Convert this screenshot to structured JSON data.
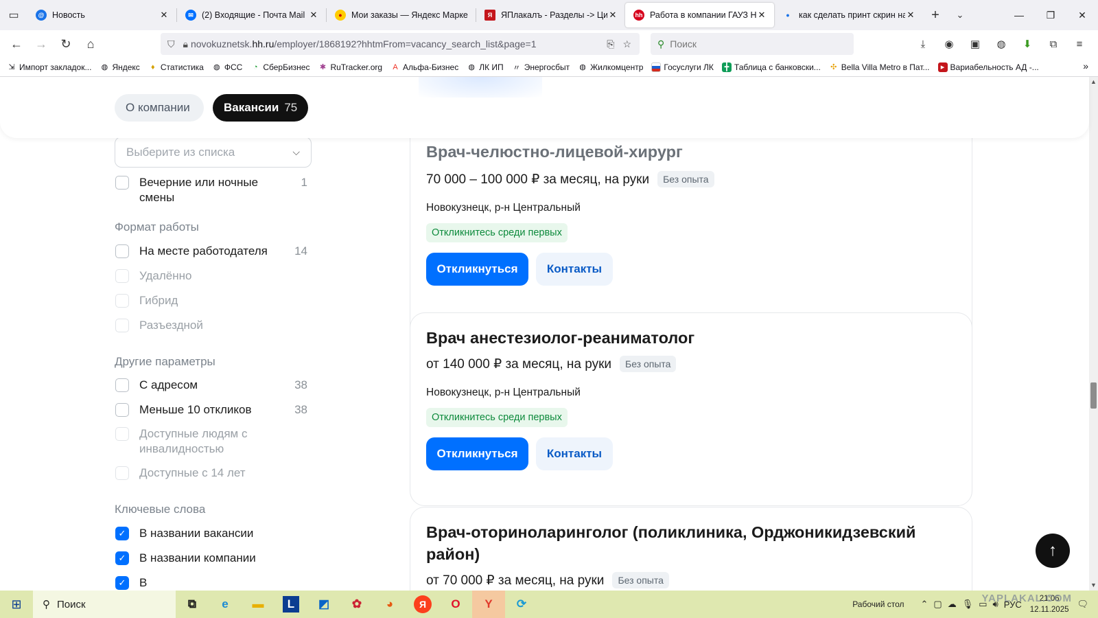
{
  "browser": {
    "tabs": [
      {
        "title": "Новость",
        "icon": "at-icon",
        "color": "#1a73e8",
        "active": false
      },
      {
        "title": "(2) Входящие - Почта Mail",
        "icon": "mail-icon",
        "color": "#0070ff",
        "active": false
      },
      {
        "title": "Мои заказы — Яндекс Марке",
        "icon": "market-icon",
        "color": "#ffcc00",
        "active": false
      },
      {
        "title": "ЯПлакалъ - Разделы -> Цити",
        "icon": "yaplakal-icon",
        "color": "#c4161c",
        "active": false
      },
      {
        "title": "Работа в компании ГАУЗ Нов",
        "icon": "hh-icon",
        "color": "#d6001c",
        "active": true
      },
      {
        "title": "как сделать принт скрин на к",
        "icon": "dot-icon",
        "color": "#1a73e8",
        "active": false
      }
    ],
    "url_prefix": "novokuznetsk.",
    "url_domain": "hh.ru",
    "url_path": "/employer/1868192?hhtmFrom=vacancy_search_list&page=1",
    "search_placeholder": "Поиск",
    "bookmarks": [
      {
        "label": "Импорт закладок...",
        "icon": "import-icon"
      },
      {
        "label": "Яндекс",
        "icon": "globe-icon"
      },
      {
        "label": "Статистика",
        "icon": "stats-icon"
      },
      {
        "label": "ФСС",
        "icon": "globe-icon"
      },
      {
        "label": "СберБизнес",
        "icon": "sber-icon"
      },
      {
        "label": "RuTracker.org",
        "icon": "rutracker-icon"
      },
      {
        "label": "Альфа-Бизнес",
        "icon": "alfa-icon"
      },
      {
        "label": "ЛК ИП",
        "icon": "globe-icon"
      },
      {
        "label": "Энергосбыт",
        "icon": "energy-icon"
      },
      {
        "label": "Жилкомцентр",
        "icon": "globe-icon"
      },
      {
        "label": "Госуслуги ЛК",
        "icon": "gosuslugi-icon"
      },
      {
        "label": "Таблица с банковски...",
        "icon": "sheets-icon"
      },
      {
        "label": "Bella Villa Metro в Пат...",
        "icon": "pinwheel-icon"
      },
      {
        "label": "Вариабельность АД -...",
        "icon": "bookmark-icon"
      }
    ]
  },
  "header": {
    "about_label": "О компании",
    "vacancies_label": "Вакансии",
    "vacancies_count": "75"
  },
  "sidebar": {
    "select_placeholder": "Выберите из списка",
    "evening_label": "Вечерние или ночные смены",
    "evening_count": "1",
    "format_title": "Формат работы",
    "format": [
      {
        "label": "На месте работодателя",
        "count": "14",
        "disabled": false
      },
      {
        "label": "Удалённо",
        "count": "",
        "disabled": true
      },
      {
        "label": "Гибрид",
        "count": "",
        "disabled": true
      },
      {
        "label": "Разъездной",
        "count": "",
        "disabled": true
      }
    ],
    "other_title": "Другие параметры",
    "other": [
      {
        "label": "С адресом",
        "count": "38",
        "disabled": false
      },
      {
        "label": "Меньше 10 откликов",
        "count": "38",
        "disabled": false
      },
      {
        "label": "Доступные людям с инвалидностью",
        "count": "",
        "disabled": true
      },
      {
        "label": "Доступные с 14 лет",
        "count": "",
        "disabled": true
      }
    ],
    "keywords_title": "Ключевые слова",
    "keywords": [
      {
        "label": "В названии вакансии",
        "checked": true
      },
      {
        "label": "В названии компании",
        "checked": true
      },
      {
        "label": "В",
        "checked": true
      }
    ]
  },
  "vacancies": [
    {
      "title": "Врач-челюстно-лицевой-хирург",
      "salary": "70 000 – 100 000 ₽ за месяц, на руки",
      "experience": "Без опыта",
      "address": "Новокузнецк, р-н Центральный",
      "badge": "Откликнитесь среди первых",
      "apply": "Откликнуться",
      "contacts": "Контакты"
    },
    {
      "title": "Врач анестезиолог-реаниматолог",
      "salary": "от 140 000 ₽ за месяц, на руки",
      "experience": "Без опыта",
      "address": "Новокузнецк, р-н Центральный",
      "badge": "Откликнитесь среди первых",
      "apply": "Откликнуться",
      "contacts": "Контакты"
    },
    {
      "title": "Врач-оториноларинголог (поликлиника, Орджоникидзевский район)",
      "salary": "от 70 000 ₽ за месяц, на руки",
      "experience": "Без опыта"
    }
  ],
  "taskbar": {
    "search_label": "Поиск",
    "desktop_label": "Рабочий стол",
    "lang": "РУС",
    "time": "21:06",
    "date": "12.11.2025",
    "watermark": "YAPLAKAL.COM"
  },
  "colors": {
    "primary": "#0070ff",
    "success": "#0d8a3c",
    "dark_pill": "#111111"
  }
}
